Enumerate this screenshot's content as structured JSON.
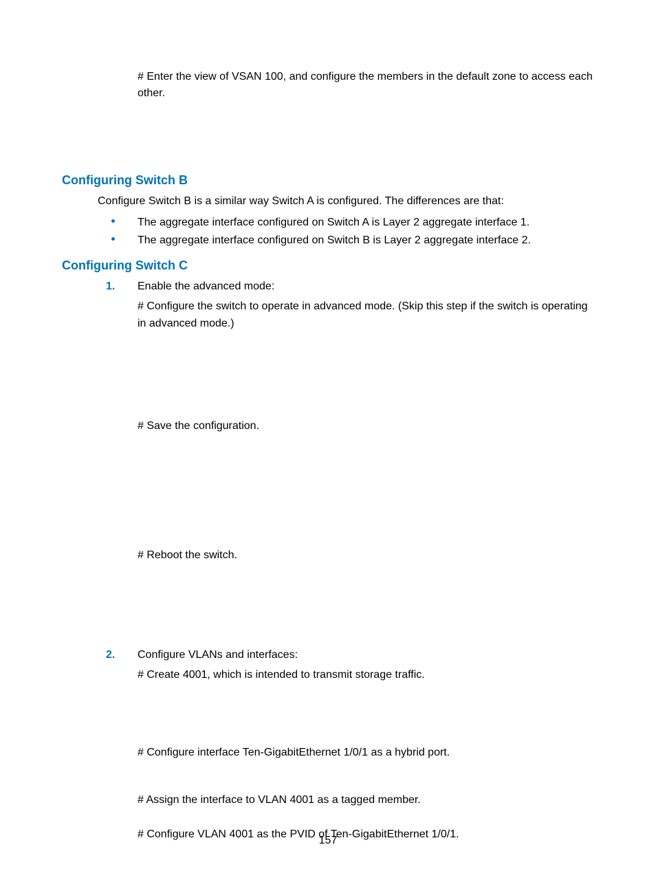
{
  "intro_para": "# Enter the view of VSAN 100, and configure the members in the default zone to access each other.",
  "section_b": {
    "heading": "Configuring Switch B",
    "intro": "Configure Switch B is a similar way Switch A is configured. The differences are that:",
    "bullets": [
      "The aggregate interface configured on Switch A is Layer 2 aggregate interface 1.",
      "The aggregate interface configured on Switch B is Layer 2 aggregate interface 2."
    ]
  },
  "section_c": {
    "heading": "Configuring Switch C",
    "steps": [
      {
        "num": "1.",
        "title": "Enable the advanced mode:",
        "lines": [
          "# Configure the switch to operate in advanced mode. (Skip this step if the switch is operating in advanced mode.)",
          "# Save the configuration.",
          "# Reboot the switch."
        ]
      },
      {
        "num": "2.",
        "title": "Configure VLANs and interfaces:",
        "lines": [
          "# Create 4001, which is intended to transmit storage traffic.",
          "# Configure interface Ten-GigabitEthernet 1/0/1 as a hybrid port.",
          "# Assign the interface to VLAN 4001 as a tagged member.",
          "# Configure VLAN 4001 as the PVID of Ten-GigabitEthernet 1/0/1."
        ]
      }
    ]
  },
  "page_number": "157"
}
